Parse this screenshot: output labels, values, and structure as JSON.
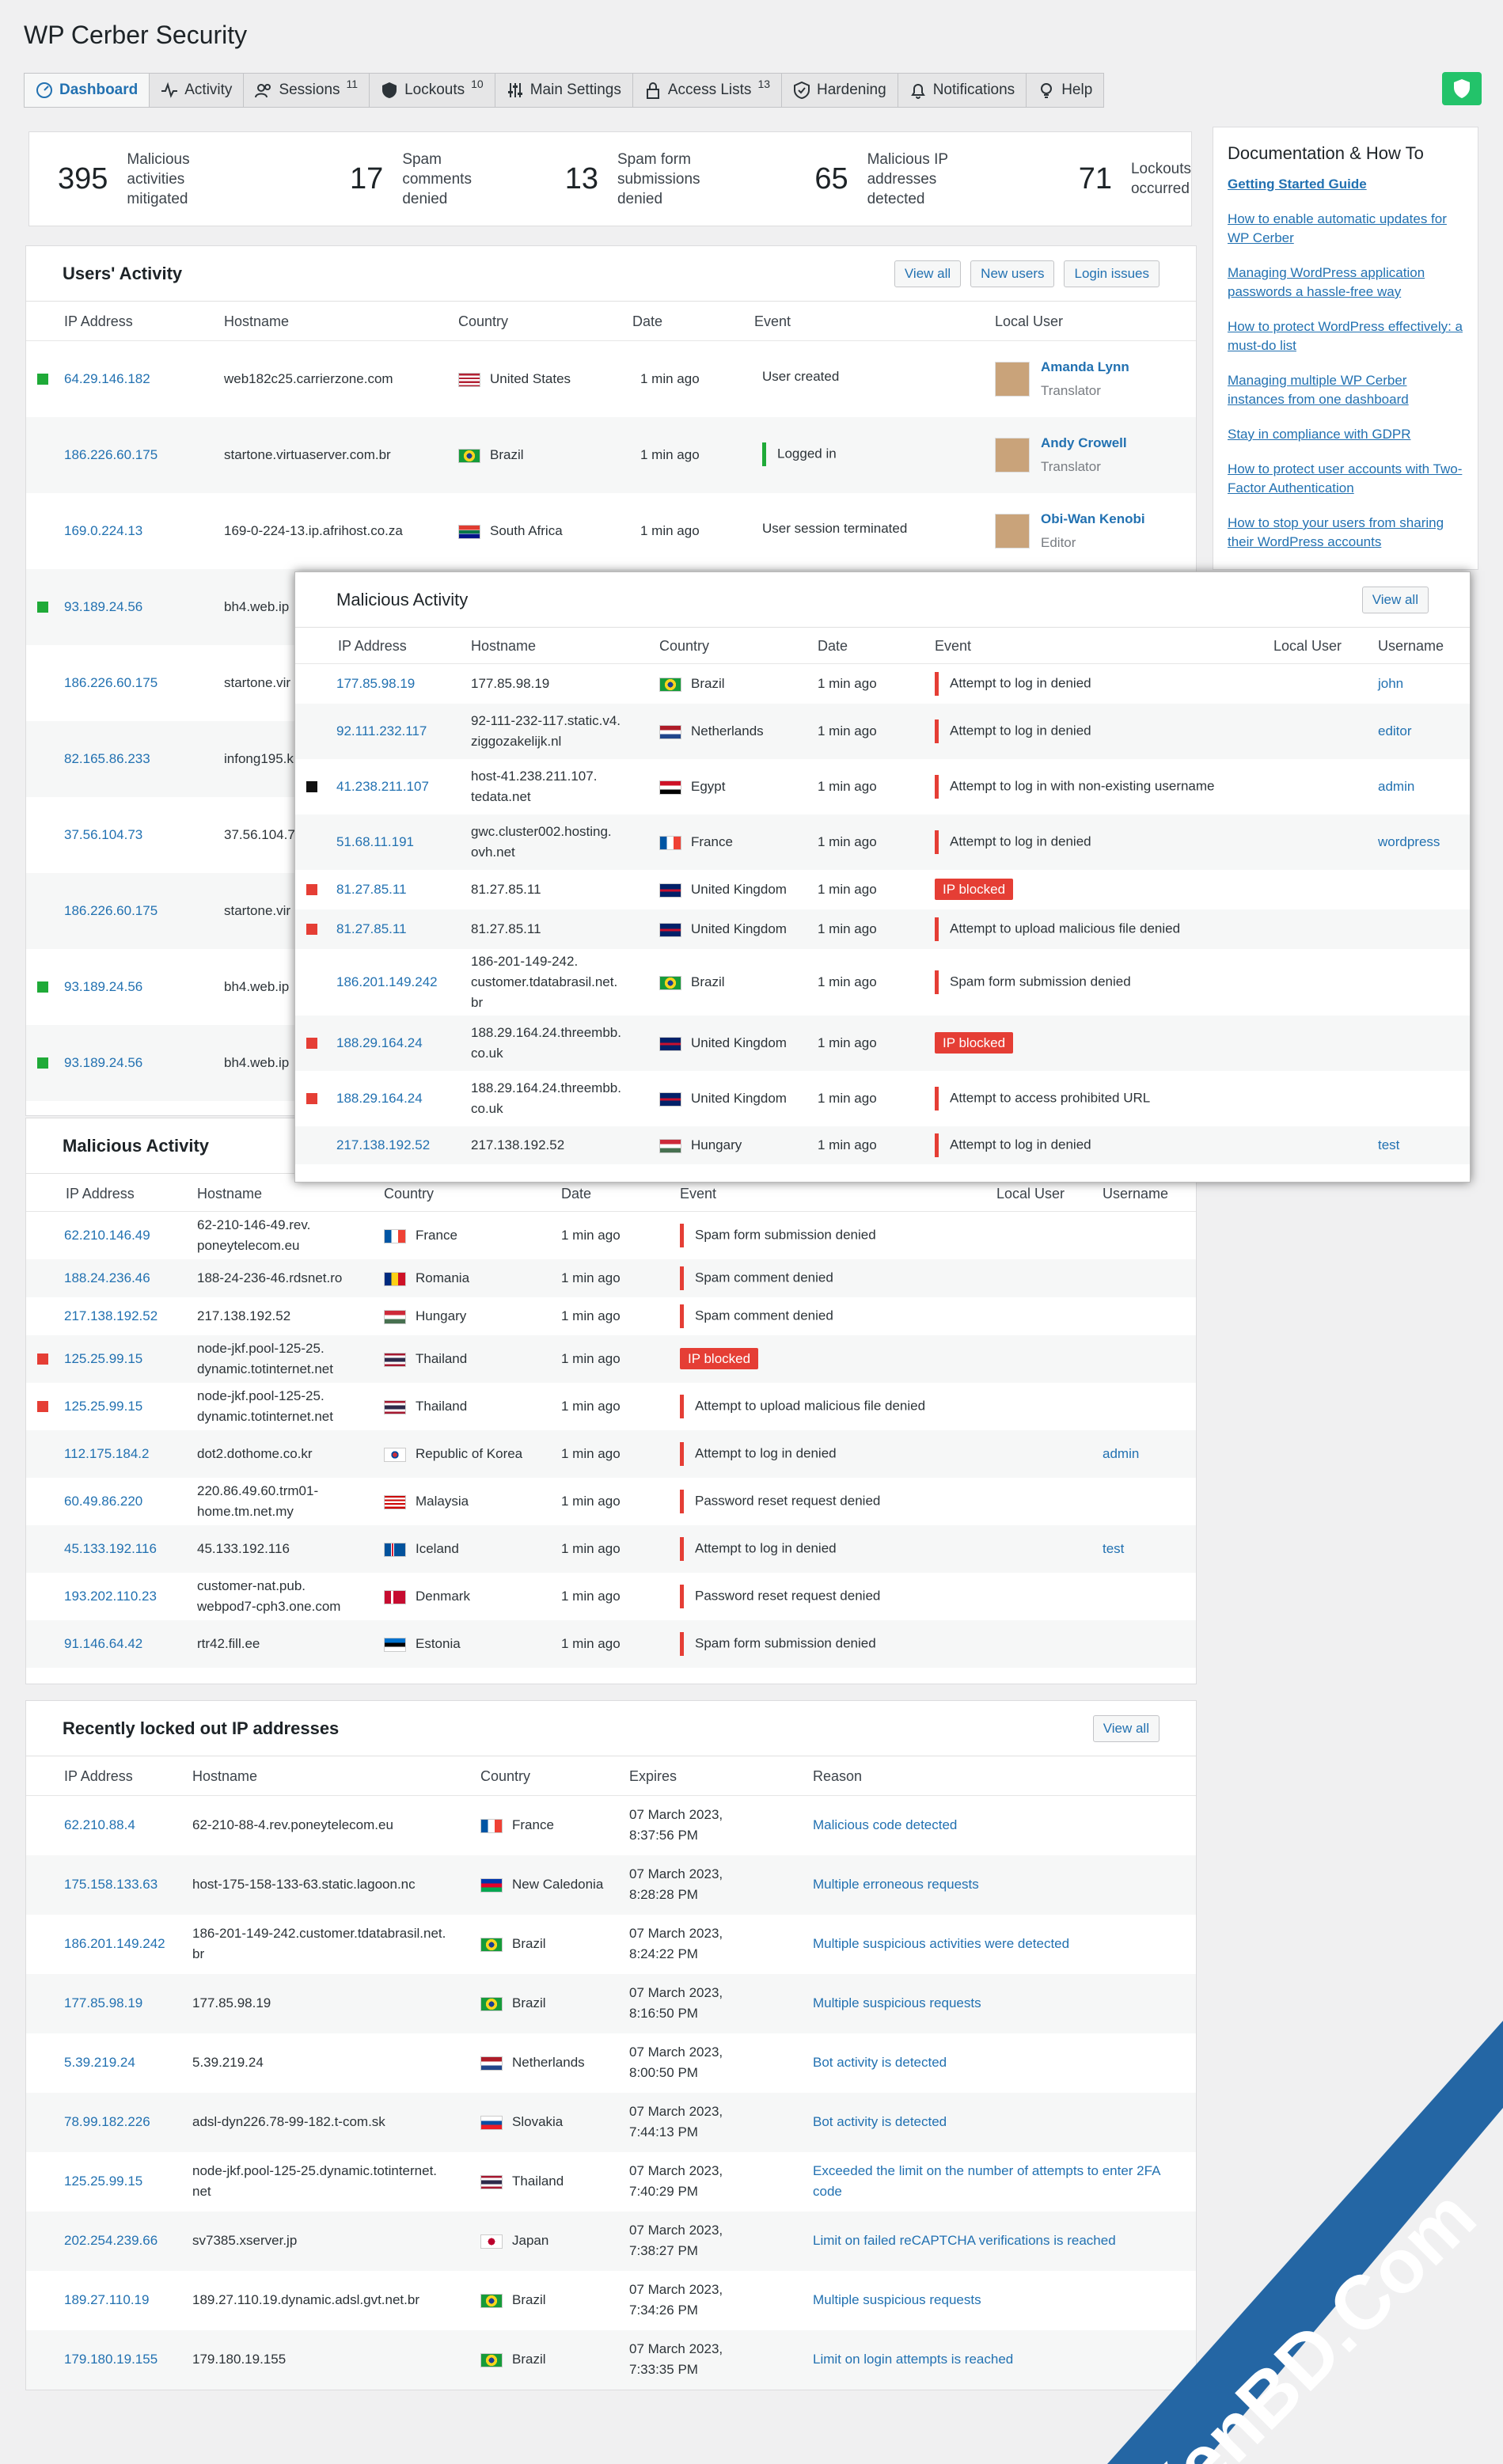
{
  "app_title": "WP Cerber Security",
  "colors": {
    "accent": "#2271b1",
    "green": "#1faa38",
    "red": "#e53e35",
    "shield": "#23c36a"
  },
  "nav": [
    {
      "label": "Dashboard",
      "icon": "dashboard-icon",
      "active": true,
      "count": ""
    },
    {
      "label": "Activity",
      "icon": "pulse-icon",
      "count": ""
    },
    {
      "label": "Sessions",
      "icon": "users-icon",
      "count": "11"
    },
    {
      "label": "Lockouts",
      "icon": "shield-icon",
      "count": "10"
    },
    {
      "label": "Main Settings",
      "icon": "sliders-icon",
      "count": ""
    },
    {
      "label": "Access Lists",
      "icon": "lock-icon",
      "count": "13"
    },
    {
      "label": "Hardening",
      "icon": "shield-check-icon",
      "count": ""
    },
    {
      "label": "Notifications",
      "icon": "bell-icon",
      "count": ""
    },
    {
      "label": "Help",
      "icon": "bulb-icon",
      "count": ""
    }
  ],
  "stats": [
    {
      "num": "395",
      "label1": "Malicious activities",
      "label2": "mitigated"
    },
    {
      "num": "17",
      "label1": "Spam comments",
      "label2": "denied"
    },
    {
      "num": "13",
      "label1": "Spam form",
      "label2": "submissions denied"
    },
    {
      "num": "65",
      "label1": "Malicious IP addresses",
      "label2": "detected"
    },
    {
      "num": "71",
      "label1": "Lockouts",
      "label2": "occurred"
    }
  ],
  "users_activity": {
    "title": "Users' Activity",
    "buttons": [
      "View all",
      "New users",
      "Login issues"
    ],
    "headers": [
      "IP Address",
      "Hostname",
      "Country",
      "Date",
      "Event",
      "Local User"
    ],
    "rows": [
      {
        "marker": "green",
        "ip": "64.29.146.182",
        "host": "web182c25.carrierzone.com",
        "country": "United States",
        "flag": "us",
        "date": "1 min ago",
        "event": "User created",
        "bar": "",
        "user": "Amanda Lynn",
        "role": "Translator"
      },
      {
        "marker": "",
        "ip": "186.226.60.175",
        "host": "startone.virtuaserver.com.br",
        "country": "Brazil",
        "flag": "br",
        "date": "1 min ago",
        "event": "Logged in",
        "bar": "green",
        "user": "Andy Crowell",
        "role": "Translator"
      },
      {
        "marker": "",
        "ip": "169.0.224.13",
        "host": "169-0-224-13.ip.afrihost.co.za",
        "country": "South Africa",
        "flag": "za",
        "date": "1 min ago",
        "event": "User session terminated",
        "bar": "",
        "user": "Obi-Wan Kenobi",
        "role": "Editor"
      },
      {
        "marker": "green",
        "ip": "93.189.24.56",
        "host": "bh4.web.ip"
      },
      {
        "marker": "",
        "ip": "186.226.60.175",
        "host": "startone.vir"
      },
      {
        "marker": "",
        "ip": "82.165.86.233",
        "host": "infong195.k"
      },
      {
        "marker": "",
        "ip": "37.56.104.73",
        "host": "37.56.104.7"
      },
      {
        "marker": "",
        "ip": "186.226.60.175",
        "host": "startone.vir"
      },
      {
        "marker": "green",
        "ip": "93.189.24.56",
        "host": "bh4.web.ip"
      },
      {
        "marker": "green",
        "ip": "93.189.24.56",
        "host": "bh4.web.ip"
      }
    ]
  },
  "malicious_activity": {
    "title": "Malicious Activity",
    "headers": [
      "IP Address",
      "Hostname",
      "Country",
      "Date",
      "Event",
      "Local User",
      "Username"
    ],
    "rows": [
      {
        "marker": "",
        "ip": "62.210.146.49",
        "host1": "62-210-146-49.rev.",
        "host2": "poneytelecom.eu",
        "country": "France",
        "flag": "fr",
        "date": "1 min ago",
        "event": "Spam form submission denied",
        "blocked": false,
        "username": ""
      },
      {
        "marker": "",
        "ip": "188.24.236.46",
        "host1": "188-24-236-46.rdsnet.ro",
        "host2": "",
        "country": "Romania",
        "flag": "ro",
        "date": "1 min ago",
        "event": "Spam comment denied",
        "blocked": false,
        "username": ""
      },
      {
        "marker": "",
        "ip": "217.138.192.52",
        "host1": "217.138.192.52",
        "host2": "",
        "country": "Hungary",
        "flag": "hu",
        "date": "1 min ago",
        "event": "Spam comment denied",
        "blocked": false,
        "username": ""
      },
      {
        "marker": "red",
        "ip": "125.25.99.15",
        "host1": "node-jkf.pool-125-25.",
        "host2": "dynamic.totinternet.net",
        "country": "Thailand",
        "flag": "th",
        "date": "1 min ago",
        "event": "IP blocked",
        "blocked": true,
        "username": ""
      },
      {
        "marker": "red",
        "ip": "125.25.99.15",
        "host1": "node-jkf.pool-125-25.",
        "host2": "dynamic.totinternet.net",
        "country": "Thailand",
        "flag": "th",
        "date": "1 min ago",
        "event": "Attempt to upload malicious file denied",
        "blocked": false,
        "username": ""
      },
      {
        "marker": "",
        "ip": "112.175.184.2",
        "host1": "dot2.dothome.co.kr",
        "host2": "",
        "country": "Republic of Korea",
        "flag": "kr",
        "date": "1 min ago",
        "event": "Attempt to log in denied",
        "blocked": false,
        "username": "admin"
      },
      {
        "marker": "",
        "ip": "60.49.86.220",
        "host1": "220.86.49.60.trm01-",
        "host2": "home.tm.net.my",
        "country": "Malaysia",
        "flag": "my",
        "date": "1 min ago",
        "event": "Password reset request denied",
        "blocked": false,
        "username": ""
      },
      {
        "marker": "",
        "ip": "45.133.192.116",
        "host1": "45.133.192.116",
        "host2": "",
        "country": "Iceland",
        "flag": "is",
        "date": "1 min ago",
        "event": "Attempt to log in denied",
        "blocked": false,
        "username": "test"
      },
      {
        "marker": "",
        "ip": "193.202.110.23",
        "host1": "customer-nat.pub.",
        "host2": "webpod7-cph3.one.com",
        "country": "Denmark",
        "flag": "dk",
        "date": "1 min ago",
        "event": "Password reset request denied",
        "blocked": false,
        "username": ""
      },
      {
        "marker": "",
        "ip": "91.146.64.42",
        "host1": "rtr42.fill.ee",
        "host2": "",
        "country": "Estonia",
        "flag": "ee",
        "date": "1 min ago",
        "event": "Spam form submission denied",
        "blocked": false,
        "username": ""
      }
    ]
  },
  "overlay": {
    "title": "Malicious Activity",
    "button": "View all",
    "headers": [
      "IP Address",
      "Hostname",
      "Country",
      "Date",
      "Event",
      "Local User",
      "Username"
    ],
    "rows": [
      {
        "marker": "",
        "ip": "177.85.98.19",
        "host1": "177.85.98.19",
        "host2": "",
        "host3": "",
        "country": "Brazil",
        "flag": "br",
        "date": "1 min ago",
        "event": "Attempt to log in denied",
        "blocked": false,
        "username": "john"
      },
      {
        "marker": "",
        "ip": "92.111.232.117",
        "host1": "92-111-232-117.static.v4.",
        "host2": "ziggozakelijk.nl",
        "host3": "",
        "country": "Netherlands",
        "flag": "nl",
        "date": "1 min ago",
        "event": "Attempt to log in denied",
        "blocked": false,
        "username": "editor"
      },
      {
        "marker": "black",
        "ip": "41.238.211.107",
        "host1": "host-41.238.211.107.",
        "host2": "tedata.net",
        "host3": "",
        "country": "Egypt",
        "flag": "eg",
        "date": "1 min ago",
        "event": "Attempt to log in with non-existing username",
        "blocked": false,
        "username": "admin"
      },
      {
        "marker": "",
        "ip": "51.68.11.191",
        "host1": "gwc.cluster002.hosting.",
        "host2": "ovh.net",
        "host3": "",
        "country": "France",
        "flag": "fr",
        "date": "1 min ago",
        "event": "Attempt to log in denied",
        "blocked": false,
        "username": "wordpress"
      },
      {
        "marker": "red",
        "ip": "81.27.85.11",
        "host1": "81.27.85.11",
        "host2": "",
        "host3": "",
        "country": "United Kingdom",
        "flag": "gb",
        "date": "1 min ago",
        "event": "IP blocked",
        "blocked": true,
        "username": ""
      },
      {
        "marker": "red",
        "ip": "81.27.85.11",
        "host1": "81.27.85.11",
        "host2": "",
        "host3": "",
        "country": "United Kingdom",
        "flag": "gb",
        "date": "1 min ago",
        "event": "Attempt to upload malicious file denied",
        "blocked": false,
        "username": ""
      },
      {
        "marker": "",
        "ip": "186.201.149.242",
        "host1": "186-201-149-242.",
        "host2": "customer.tdatabrasil.net.",
        "host3": "br",
        "country": "Brazil",
        "flag": "br",
        "date": "1 min ago",
        "event": "Spam form submission denied",
        "blocked": false,
        "username": ""
      },
      {
        "marker": "red",
        "ip": "188.29.164.24",
        "host1": "188.29.164.24.threembb.",
        "host2": "co.uk",
        "host3": "",
        "country": "United Kingdom",
        "flag": "gb",
        "date": "1 min ago",
        "event": "IP blocked",
        "blocked": true,
        "username": ""
      },
      {
        "marker": "red",
        "ip": "188.29.164.24",
        "host1": "188.29.164.24.threembb.",
        "host2": "co.uk",
        "host3": "",
        "country": "United Kingdom",
        "flag": "gb",
        "date": "1 min ago",
        "event": "Attempt to access prohibited URL",
        "blocked": false,
        "username": ""
      },
      {
        "marker": "",
        "ip": "217.138.192.52",
        "host1": "217.138.192.52",
        "host2": "",
        "host3": "",
        "country": "Hungary",
        "flag": "hu",
        "date": "1 min ago",
        "event": "Attempt to log in denied",
        "blocked": false,
        "username": "test"
      }
    ]
  },
  "lockouts": {
    "title": "Recently locked out IP addresses",
    "button": "View all",
    "headers": [
      "IP Address",
      "Hostname",
      "Country",
      "Expires",
      "Reason"
    ],
    "rows": [
      {
        "ip": "62.210.88.4",
        "host1": "62-210-88-4.rev.poneytelecom.eu",
        "host2": "",
        "country": "France",
        "flag": "fr",
        "exp1": "07 March 2023,",
        "exp2": "8:37:56 PM",
        "reason1": "Malicious code detected",
        "reason2": ""
      },
      {
        "ip": "175.158.133.63",
        "host1": "host-175-158-133-63.static.lagoon.nc",
        "host2": "",
        "country": "New Caledonia",
        "flag": "nc",
        "exp1": "07 March 2023,",
        "exp2": "8:28:28 PM",
        "reason1": "Multiple erroneous requests",
        "reason2": ""
      },
      {
        "ip": "186.201.149.242",
        "host1": "186-201-149-242.customer.tdatabrasil.net.",
        "host2": "br",
        "country": "Brazil",
        "flag": "br",
        "exp1": "07 March 2023,",
        "exp2": "8:24:22 PM",
        "reason1": "Multiple suspicious activities were detected",
        "reason2": ""
      },
      {
        "ip": "177.85.98.19",
        "host1": "177.85.98.19",
        "host2": "",
        "country": "Brazil",
        "flag": "br",
        "exp1": "07 March 2023,",
        "exp2": "8:16:50 PM",
        "reason1": "Multiple suspicious requests",
        "reason2": ""
      },
      {
        "ip": "5.39.219.24",
        "host1": "5.39.219.24",
        "host2": "",
        "country": "Netherlands",
        "flag": "nl",
        "exp1": "07 March 2023,",
        "exp2": "8:00:50 PM",
        "reason1": "Bot activity is detected",
        "reason2": ""
      },
      {
        "ip": "78.99.182.226",
        "host1": "adsl-dyn226.78-99-182.t-com.sk",
        "host2": "",
        "country": "Slovakia",
        "flag": "sk",
        "exp1": "07 March 2023,",
        "exp2": "7:44:13 PM",
        "reason1": "Bot activity is detected",
        "reason2": ""
      },
      {
        "ip": "125.25.99.15",
        "host1": "node-jkf.pool-125-25.dynamic.totinternet.",
        "host2": "net",
        "country": "Thailand",
        "flag": "th",
        "exp1": "07 March 2023,",
        "exp2": "7:40:29 PM",
        "reason1": "Exceeded the limit on the number of attempts to enter 2FA",
        "reason2": "code"
      },
      {
        "ip": "202.254.239.66",
        "host1": "sv7385.xserver.jp",
        "host2": "",
        "country": "Japan",
        "flag": "jp",
        "exp1": "07 March 2023,",
        "exp2": "7:38:27 PM",
        "reason1": "Limit on failed reCAPTCHA verifications is reached",
        "reason2": ""
      },
      {
        "ip": "189.27.110.19",
        "host1": "189.27.110.19.dynamic.adsl.gvt.net.br",
        "host2": "",
        "country": "Brazil",
        "flag": "br",
        "exp1": "07 March 2023,",
        "exp2": "7:34:26 PM",
        "reason1": "Multiple suspicious requests",
        "reason2": ""
      },
      {
        "ip": "179.180.19.155",
        "host1": "179.180.19.155",
        "host2": "",
        "country": "Brazil",
        "flag": "br",
        "exp1": "07 March 2023,",
        "exp2": "7:33:35 PM",
        "reason1": "Limit on login attempts is reached",
        "reason2": ""
      }
    ]
  },
  "docs": {
    "title": "Documentation & How To",
    "links": [
      "Getting Started Guide",
      "How to enable automatic updates for WP Cerber",
      "Managing WordPress application passwords a hassle-free way",
      "How to protect WordPress effectively: a must-do list",
      "Managing multiple WP Cerber instances from one dashboard",
      "Stay in compliance with GDPR",
      "How to protect user accounts with Two-Factor Authentication",
      "How to stop your users from sharing their WordPress accounts"
    ]
  },
  "watermark": "XenBD.Com"
}
